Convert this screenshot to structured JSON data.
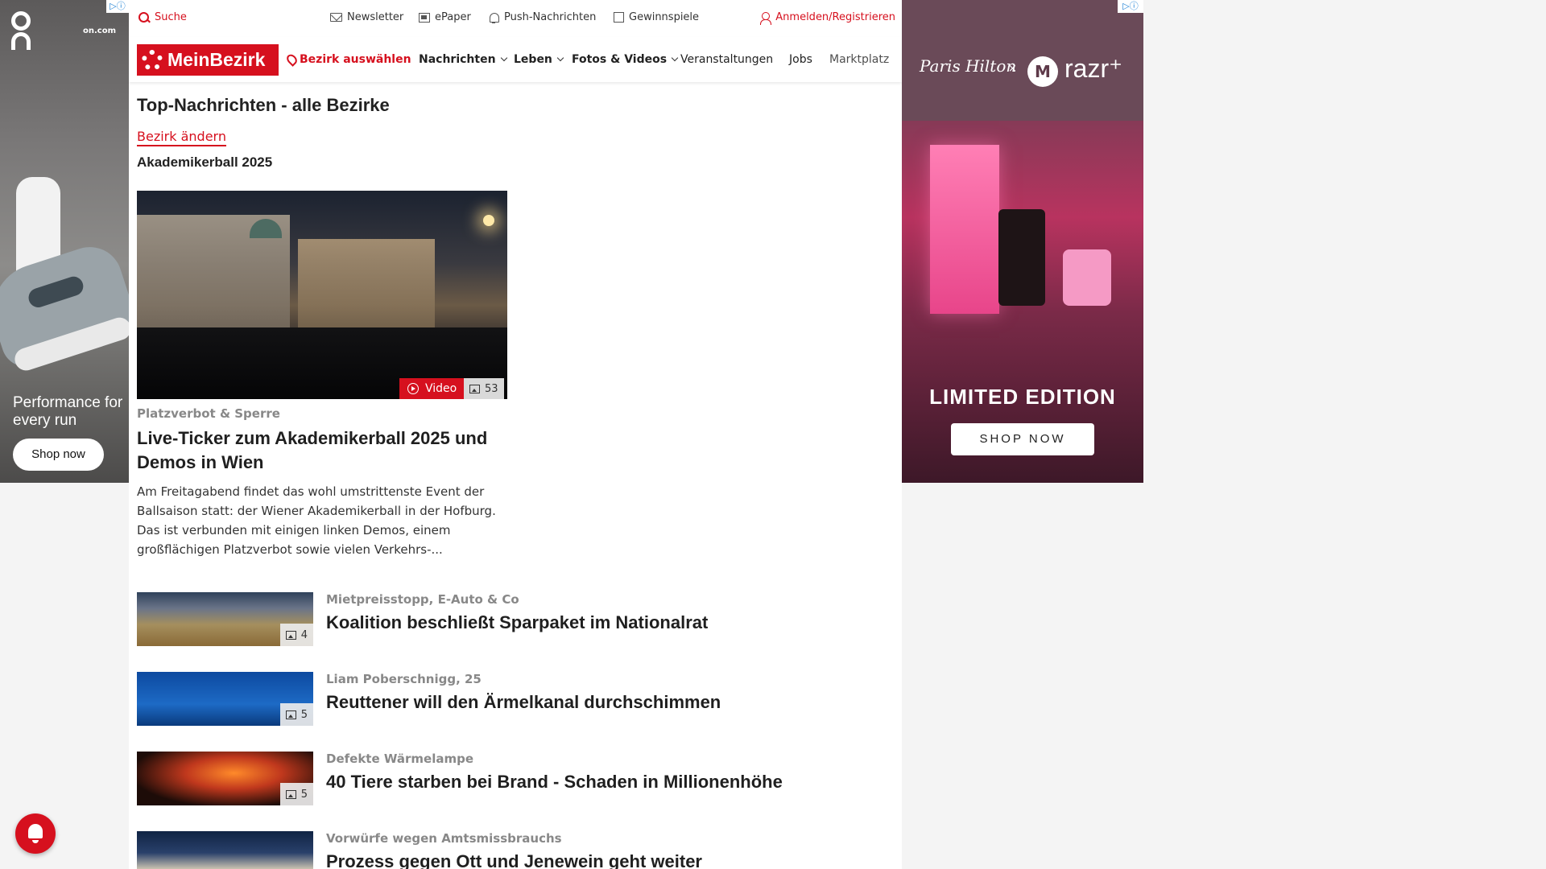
{
  "ad_left": {
    "domain": "on.com",
    "tagline": "Performance for every run",
    "cta": "Shop now",
    "adchoices": "▷ⓘ"
  },
  "topbar": {
    "search": "Suche",
    "newsletter": "Newsletter",
    "epaper": "ePaper",
    "push": "Push-Nachrichten",
    "gewinnspiele": "Gewinnspiele",
    "login": "Anmelden/Registrieren"
  },
  "nav": {
    "brand": "MeinBezirk",
    "location": "Bezirk auswählen",
    "items": [
      "Nachrichten",
      "Leben",
      "Fotos & Videos",
      "Veranstaltungen",
      "Jobs",
      "Marktplatz"
    ]
  },
  "page": {
    "title": "Top-Nachrichten - alle Bezirke",
    "change_link": "Bezirk ändern",
    "section": "Akademikerball 2025"
  },
  "hero": {
    "video_label": "Video",
    "photo_count": "53",
    "kicker": "Platzverbot & Sperre",
    "title": "Live-Ticker zum Akademikerball 2025 und Demos in Wien",
    "teaser": "Am Freitagabend findet das wohl umstrittenste Event der Ballsaison statt: der Wiener Akademikerball in der Hofburg. Das ist verbunden mit einigen linken Demos, einem großflächigen Platzverbot sowie vielen Verkehrs-..."
  },
  "articles": [
    {
      "kicker": "Mietpreisstopp, E-Auto & Co",
      "title": "Koalition beschließt Sparpaket im Nationalrat",
      "count": "4"
    },
    {
      "kicker": "Liam Poberschnigg, 25",
      "title": "Reuttener will den Ärmelkanal durchschimmen",
      "count": "5"
    },
    {
      "kicker": "Defekte Wärmelampe",
      "title": "40 Tiere starben bei Brand - Schaden in Millionenhöhe",
      "count": "5"
    },
    {
      "kicker": "Vorwürfe wegen Amtsmissbrauchs",
      "title": "Prozess gegen Ott und Jenewein geht weiter",
      "count": ""
    }
  ],
  "ad_right": {
    "signature": "Paris Hilton",
    "brand": "razr⁺",
    "headline": "LIMITED EDITION",
    "cta": "SHOP NOW",
    "adchoices": "▷ⓘ"
  },
  "colors": {
    "accent": "#d6101e",
    "text": "#1f1f1f",
    "kicker": "#888888"
  }
}
